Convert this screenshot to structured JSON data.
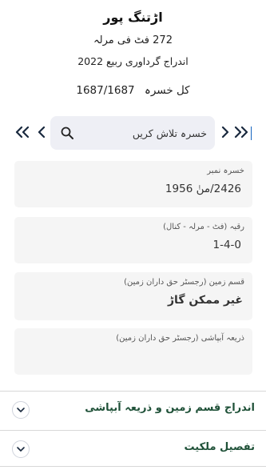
{
  "header": {
    "village": "اڑتنگ پور",
    "per_marla": "272 فٹ فی مرلہ",
    "entry": "اندراج گرداوری ربیع 2022",
    "total_label": "کل خسرہ",
    "total_value": "1687/1687"
  },
  "nav": {
    "first_icon": "double-chevron-left-icon",
    "prev_icon": "chevron-left-icon",
    "next_icon": "chevron-right-icon",
    "last_icon": "double-chevron-right-icon",
    "search_placeholder": "خسرہ تلاش کریں",
    "search_value": ""
  },
  "cards": [
    {
      "label": "خسرہ نمبر",
      "value": "2426/منٰ 1956"
    },
    {
      "label": "رقبہ (فٹ - مرلہ - کنال)",
      "value": "1-4-0"
    },
    {
      "label": "قسم زمین (رجسٹر حق داران زمین)",
      "value": "غیر ممکن گاڑ"
    },
    {
      "label": "ذریعہ آبپاشی (رجسٹر حق داران زمین)",
      "value": ""
    }
  ],
  "sections": [
    {
      "title": "اندراج قسم زمین و ذریعہ آبپاشی",
      "icon": "chevron-down-icon"
    },
    {
      "title": "تفصیل ملکیت",
      "icon": "chevron-down-icon"
    }
  ],
  "colors": {
    "accent": "#1f5138",
    "search_bg": "#eeeff5",
    "card_bg": "#f5f5f5",
    "nav": "#1a2a3f"
  }
}
